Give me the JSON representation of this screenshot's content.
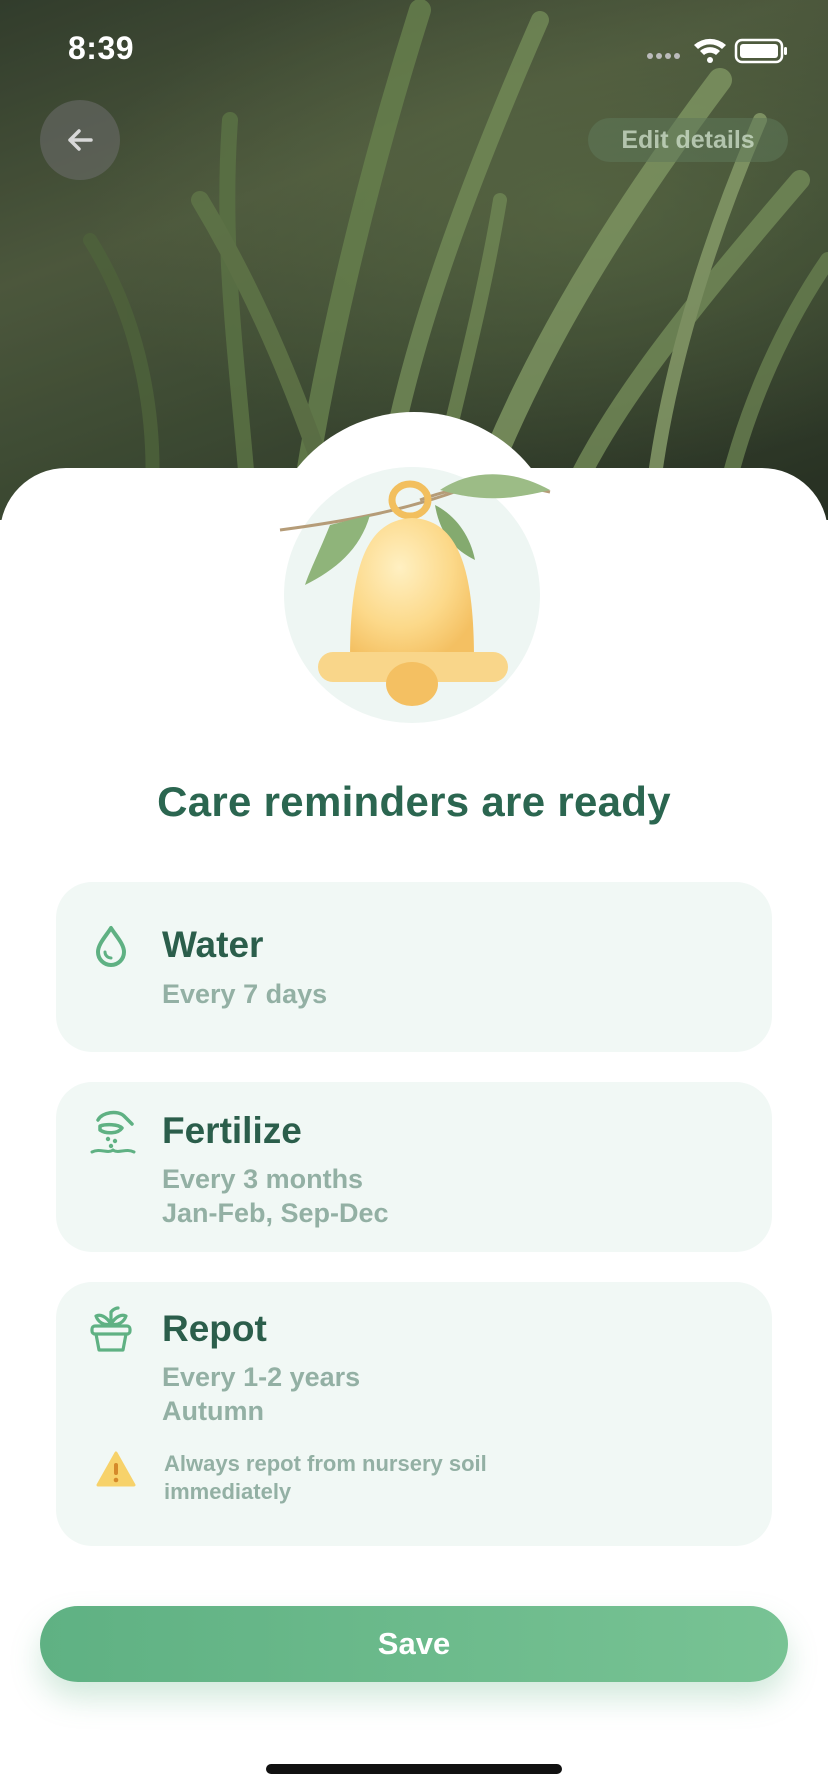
{
  "status_bar": {
    "time": "8:39"
  },
  "header": {
    "back_icon": "arrow-left-icon",
    "edit_label": "Edit details"
  },
  "illustration": {
    "icon": "bell-with-leaves-icon"
  },
  "main": {
    "title": "Care reminders are ready",
    "reminders": [
      {
        "icon": "water-drop-icon",
        "title": "Water",
        "lines": [
          "Every 7 days"
        ]
      },
      {
        "icon": "fertilize-icon",
        "title": "Fertilize",
        "lines": [
          "Every 3 months",
          "Jan-Feb, Sep-Dec"
        ]
      },
      {
        "icon": "pot-plant-icon",
        "title": "Repot",
        "lines": [
          "Every 1-2 years",
          "Autumn"
        ],
        "warning": {
          "icon": "warning-icon",
          "text": "Always repot from nursery soil immediately"
        }
      }
    ]
  },
  "footer": {
    "save_label": "Save"
  },
  "colors": {
    "accent": "#5fb183",
    "title": "#2b6650",
    "card_bg": "#f1f8f5",
    "subtext": "#93b0a4",
    "warning": "#f5c95a"
  }
}
